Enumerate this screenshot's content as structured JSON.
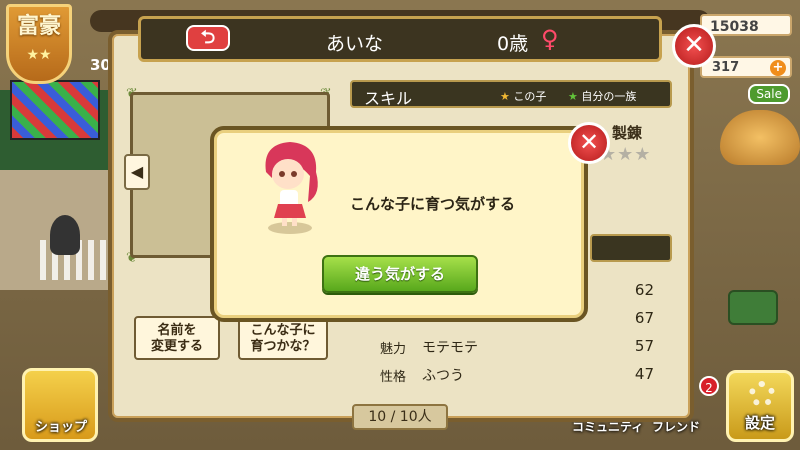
{
  "background": {
    "title_badge": "富豪",
    "title_stars": "★★",
    "left_number": "30",
    "coins": "15038",
    "gems": "317",
    "gems_plus": "+",
    "sale": "Sale",
    "shop_label": "ショップ",
    "community_label": "コミュニティ",
    "friend_label": "フレンド",
    "friend_badge": "2",
    "settings_label": "設定"
  },
  "header": {
    "back_icon": "⮌",
    "child_name": "あいな",
    "age": "0歳",
    "gender_symbol": "♀"
  },
  "skills": {
    "title": "スキル",
    "legend_this_child": "この子",
    "legend_family": "自分の一族",
    "forging_label": "製錬",
    "forging_stars": "★★★"
  },
  "stats": [
    {
      "label": "",
      "desc": "",
      "value": "62"
    },
    {
      "label": "",
      "desc": "",
      "value": "67"
    },
    {
      "label": "魅力",
      "desc": "モテモテ",
      "value": "57"
    },
    {
      "label": "性格",
      "desc": "ふつう",
      "value": "47"
    }
  ],
  "buttons": {
    "rename": "名前を\n変更する",
    "grow": "こんな子に\n育つかな？"
  },
  "page_indicator": "10 / 10人",
  "dialog": {
    "message": "こんな子に育つ気がする",
    "button": "違う気がする",
    "close": "✕"
  },
  "colors": {
    "panel_bg": "#ece3c4",
    "header_bg": "#3c3420",
    "accent_green": "#58a81c",
    "close_red": "#d83030"
  }
}
